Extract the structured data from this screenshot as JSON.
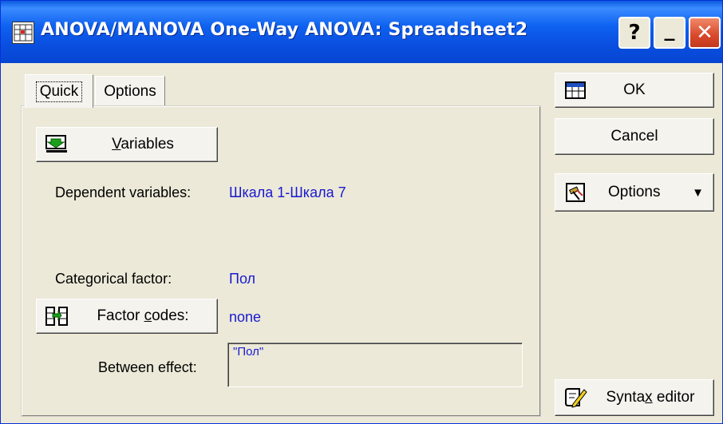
{
  "window": {
    "title": "ANOVA/MANOVA One-Way ANOVA: Spreadsheet2",
    "help_glyph": "?",
    "minimize_glyph": "_",
    "close_glyph": "✕"
  },
  "tabs": [
    {
      "label": "Quick"
    },
    {
      "label": "Options"
    }
  ],
  "quick": {
    "variables_button": {
      "mnemonic": "V",
      "rest": "ariables"
    },
    "dependent_label": "Dependent variables:",
    "dependent_value": "Шкала 1-Шкала 7",
    "categorical_label": "Categorical factor:",
    "categorical_value": "Пол",
    "factor_codes_button": {
      "before": "Factor ",
      "mnemonic": "c",
      "rest": "odes:"
    },
    "factor_codes_value": "none",
    "between_label": "Between effect:",
    "between_value": "\"Пол\""
  },
  "side": {
    "ok_label": "OK",
    "cancel_label": "Cancel",
    "options_label": "Options",
    "options_arrow": "▼",
    "syntax_before": "Synta",
    "syntax_mnemonic": "x",
    "syntax_rest": " editor"
  },
  "icons": {
    "variables": "variables-icon",
    "factor_codes": "factor-codes-icon",
    "ok": "ok-icon",
    "options": "options-icon",
    "syntax": "syntax-editor-icon"
  }
}
